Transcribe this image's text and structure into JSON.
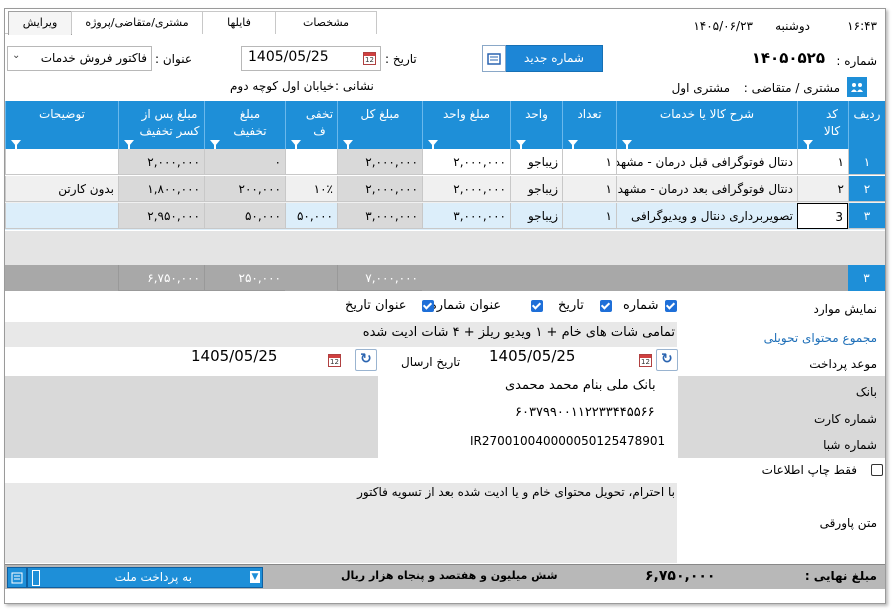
{
  "header": {
    "time": "۱۶:۴۳",
    "day": "دوشنبه",
    "date": "۱۴۰۵/۰۶/۲۳",
    "tabs": [
      "ویرایش",
      "مشتری/متقاضی/پروژه",
      "فایلها",
      "مشخصات"
    ],
    "active_tab": "ویرایش"
  },
  "form": {
    "number_label": "شماره :",
    "number_value": "۱۴۰۵۰۵۲۵",
    "new_number_button": "شماره جدید",
    "date_label": "تاریخ :",
    "date_value": "1405/05/25",
    "title_label": "عنوان :",
    "title_value": "فاکتور فروش خدمات",
    "customer_label": "مشتری / متقاضی :",
    "customer_value": "مشتری اول",
    "address_label": "نشانی :",
    "address_value": "خیابان اول کوچه دوم"
  },
  "grid": {
    "headers": {
      "row": "ردیف",
      "code": "کد کالا",
      "description": "شرح کالا یا خدمات",
      "qty": "تعداد",
      "unit": "واحد",
      "unit_price": "مبلغ واحد",
      "total": "مبلغ کل",
      "discount_pct": "تخفی ف",
      "discount_amount": "مبلغ تخفیف",
      "after_discount": "مبلغ پس از کسر تخفیف",
      "notes": "توضیحات"
    },
    "rows": [
      {
        "row": "۱",
        "code": "۱",
        "description": "دنتال فوتوگرافی قبل درمان - مشهد",
        "qty": "۱",
        "unit": "زیباجو",
        "unit_price": "۲,۰۰۰,۰۰۰",
        "total": "۲,۰۰۰,۰۰۰",
        "discount_pct": "",
        "discount_amount": "۰",
        "after_discount": "۲,۰۰۰,۰۰۰",
        "notes": ""
      },
      {
        "row": "۲",
        "code": "۲",
        "description": "دنتال فوتوگرافی بعد درمان - مشهد",
        "qty": "۱",
        "unit": "زیباجو",
        "unit_price": "۲,۰۰۰,۰۰۰",
        "total": "۲,۰۰۰,۰۰۰",
        "discount_pct": "۱۰٪",
        "discount_amount": "۲۰۰,۰۰۰",
        "after_discount": "۱,۸۰۰,۰۰۰",
        "notes": "بدون کارتن"
      },
      {
        "row": "۳",
        "code": "3",
        "description": "تصویربرداری دنتال و ویدیوگرافی",
        "qty": "۱",
        "unit": "زیباجو",
        "unit_price": "۳,۰۰۰,۰۰۰",
        "total": "۳,۰۰۰,۰۰۰",
        "discount_pct": "۵۰,۰۰۰",
        "discount_amount": "۵۰,۰۰۰",
        "after_discount": "۲,۹۵۰,۰۰۰",
        "notes": ""
      }
    ],
    "footer": {
      "row": "۳",
      "total": "۷,۰۰۰,۰۰۰",
      "discount_amount": "۲۵۰,۰۰۰",
      "after_discount": "۶,۷۵۰,۰۰۰"
    }
  },
  "details": {
    "show_items_label": "نمایش موارد",
    "options": [
      "شماره",
      "تاریخ",
      "عنوان شماره",
      "عنوان تاریخ"
    ],
    "delivery_link": "مجموع محتوای تحویلی",
    "delivery_text": "تمامی شات های خام + ۱ ویدیو ریلز + ۴ شات ادیت شده",
    "due_label": "موعد پرداخت",
    "due_date": "1405/05/25",
    "send_label": "تاریخ ارسال",
    "send_date": "1405/05/25",
    "bank_label": "بانک",
    "bank_value": "بانک ملی بنام محمد محمدی",
    "card_label": "شماره کارت",
    "card_value": "۶۰۳۷۹۹۰۰۱۱۲۲۳۳۴۴۵۵۶۶",
    "sheba_label": "شماره شبا",
    "sheba_value": "IR270010040000050125478901",
    "print_only_label": "فقط چاپ اطلاعات",
    "footer_label": "متن پاورقی",
    "footer_text": "با احترام، تحویل محتوای خام و یا ادیت شده بعد از تسویه فاکتور"
  },
  "statusbar": {
    "final_label": "مبلغ نهایی :",
    "final_value": "۶,۷۵۰,۰۰۰",
    "words": "شش میلیون و هفتصد و پنجاه  هزار  ریال",
    "payment_select": "به پرداخت ملت"
  },
  "colors": {
    "accent": "#1e8fd8",
    "grey": "#d9d9d9"
  }
}
